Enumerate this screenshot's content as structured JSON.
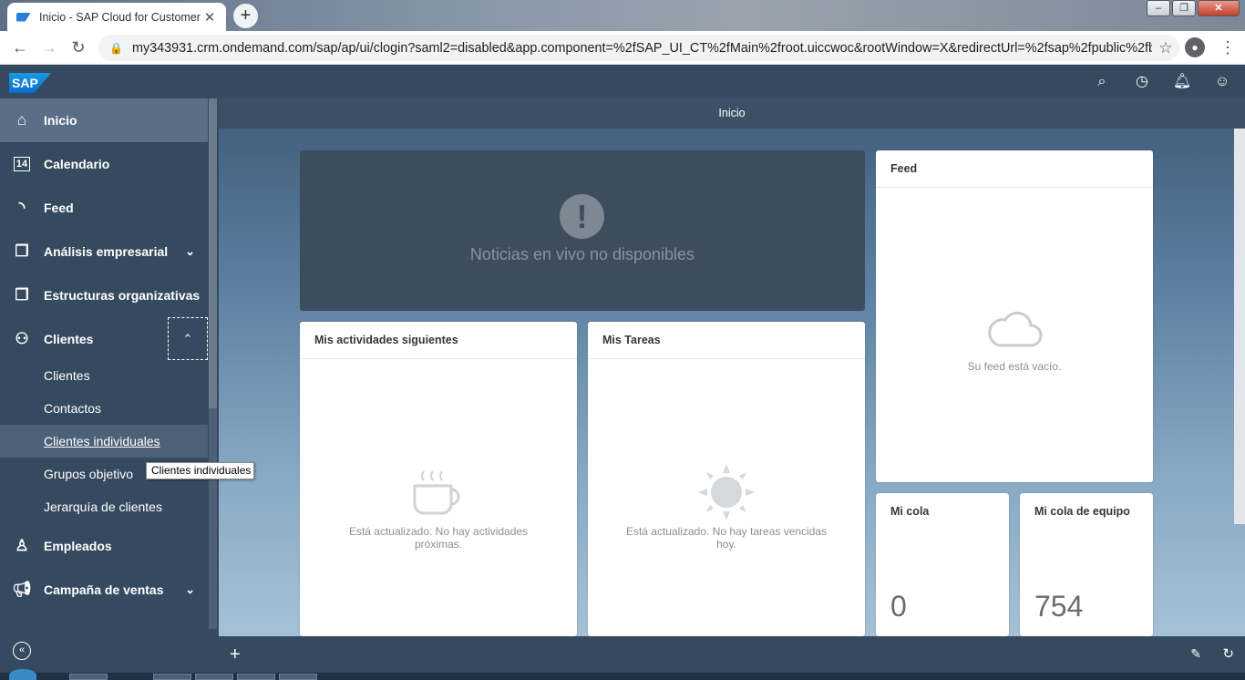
{
  "browser": {
    "tab_title": "Inicio - SAP Cloud for Customer",
    "new_tab_label": "+",
    "url": "my343931.crm.ondemand.com/sap/ap/ui/clogin?saml2=disabled&app.component=%2fSAP_UI_CT%2fMain%2froot.uiccwoc&rootWindow=X&redirectUrl=%2fsap%2fpublic%2fb..."
  },
  "shell": {
    "logo": "SAP",
    "icons": [
      "search-icon",
      "history-icon",
      "notifications-icon",
      "user-icon"
    ]
  },
  "sidebar": {
    "items": [
      {
        "label": "Inicio",
        "icon": "home-icon"
      },
      {
        "label": "Calendario",
        "icon": "calendar-icon",
        "badge": "14"
      },
      {
        "label": "Feed",
        "icon": "feed-icon"
      },
      {
        "label": "Análisis empresarial",
        "icon": "analytics-icon"
      },
      {
        "label": "Estructuras organizativas",
        "icon": "org-icon"
      },
      {
        "label": "Clientes",
        "icon": "customers-icon"
      },
      {
        "label": "Empleados",
        "icon": "employee-icon"
      },
      {
        "label": "Campaña de ventas",
        "icon": "campaign-icon"
      }
    ],
    "subitems": [
      "Clientes",
      "Contactos",
      "Clientes individuales",
      "Grupos objetivo",
      "Jerarquía de clientes"
    ]
  },
  "tooltip": "Clientes individuales",
  "main": {
    "title": "Inicio",
    "news_message": "Noticias en vivo no disponibles",
    "cards": {
      "activities": {
        "title": "Mis actividades siguientes",
        "empty": "Está actualizado. No hay actividades próximas."
      },
      "tasks": {
        "title": "Mis Tareas",
        "empty": "Está actualizado. No hay tareas vencidas hoy."
      },
      "feed": {
        "title": "Feed",
        "empty": "Su feed está vacío."
      },
      "queue": {
        "title": "Mi cola",
        "value": "0"
      },
      "team_queue": {
        "title": "Mi cola de equipo",
        "value": "754"
      }
    }
  },
  "colors": {
    "shell": "#354a5f",
    "accent": "#0a6ed1"
  }
}
